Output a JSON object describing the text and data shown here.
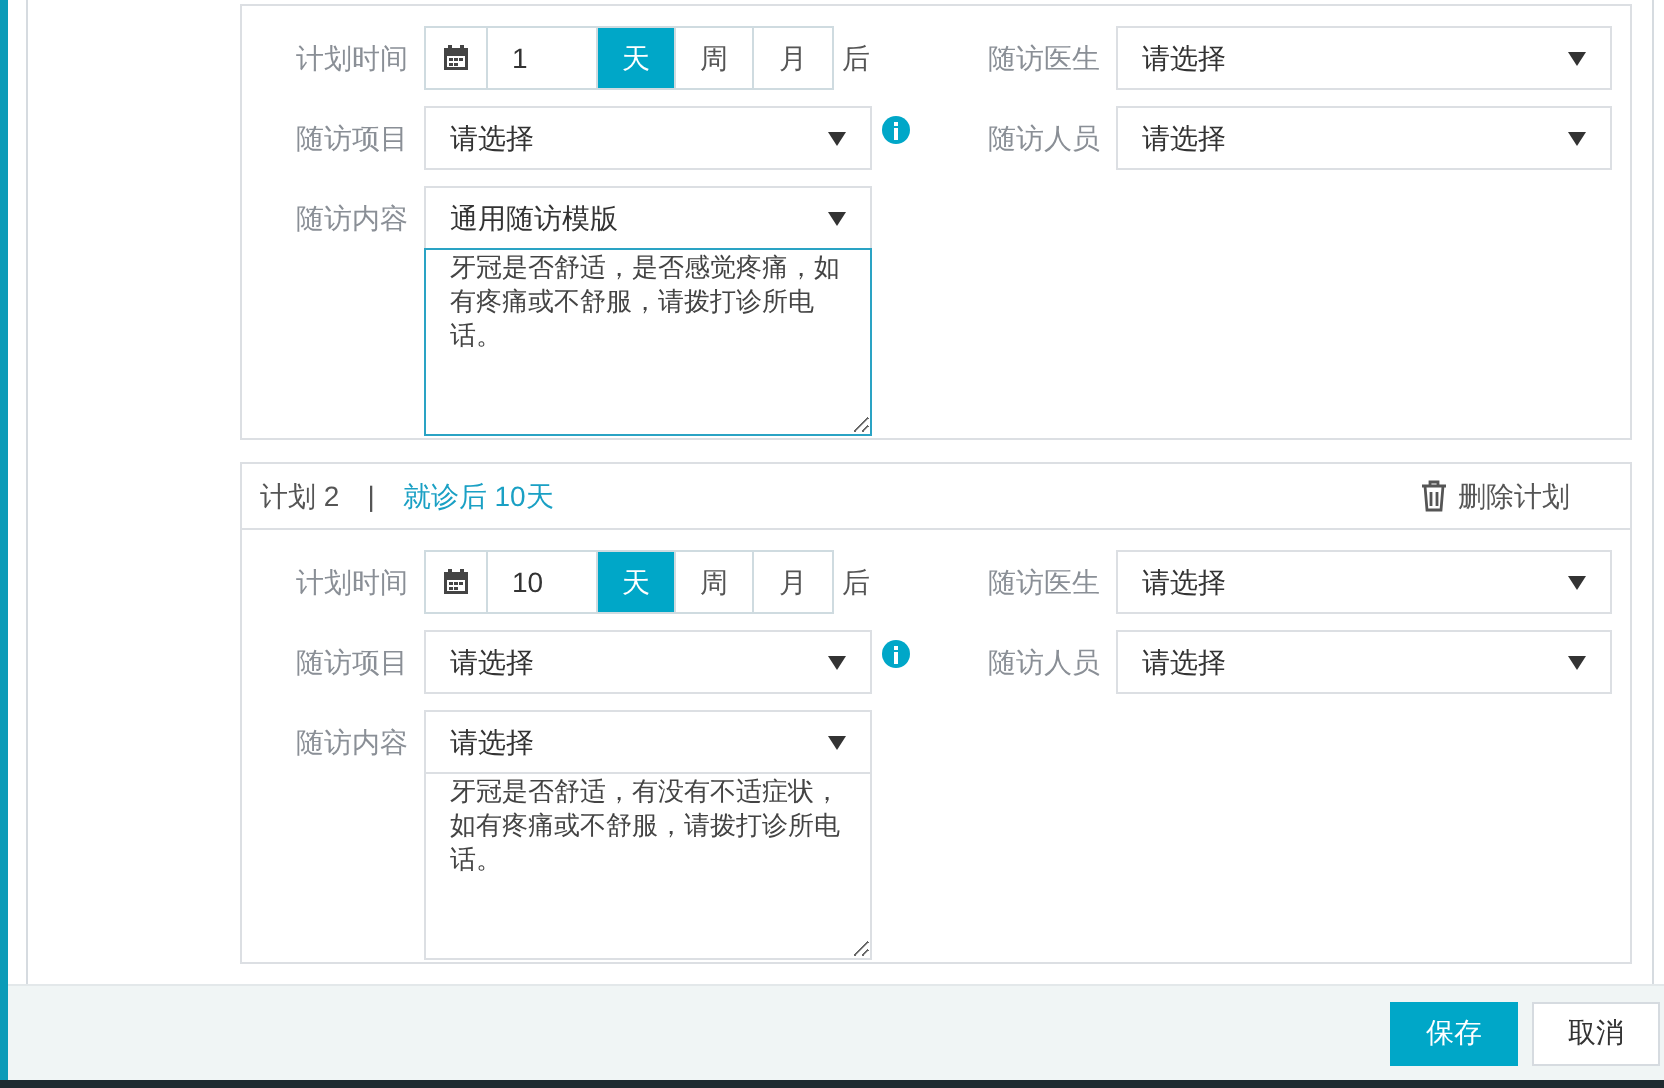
{
  "plans": [
    {
      "time": {
        "label": "计划时间",
        "value": "1",
        "units": [
          {
            "label": "天",
            "selected": true
          },
          {
            "label": "周",
            "selected": false
          },
          {
            "label": "月",
            "selected": false
          }
        ],
        "suffix": "后"
      },
      "doctor": {
        "label": "随访医生",
        "value": "请选择"
      },
      "item": {
        "label": "随访项目",
        "value": "请选择"
      },
      "staff": {
        "label": "随访人员",
        "value": "请选择"
      },
      "content": {
        "label": "随访内容",
        "value": "通用随访模版",
        "text": "牙冠是否舒适，是否感觉疼痛，如有疼痛或不舒服，请拨打诊所电话。",
        "focused": true
      }
    },
    {
      "header": {
        "title": "计划 2",
        "separator": "|",
        "summary": "就诊后 10天",
        "delete": "删除计划"
      },
      "time": {
        "label": "计划时间",
        "value": "10",
        "units": [
          {
            "label": "天",
            "selected": true
          },
          {
            "label": "周",
            "selected": false
          },
          {
            "label": "月",
            "selected": false
          }
        ],
        "suffix": "后"
      },
      "doctor": {
        "label": "随访医生",
        "value": "请选择"
      },
      "item": {
        "label": "随访项目",
        "value": "请选择"
      },
      "staff": {
        "label": "随访人员",
        "value": "请选择"
      },
      "content": {
        "label": "随访内容",
        "value": "请选择",
        "text": "牙冠是否舒适，有没有不适症状，如有疼痛或不舒服，请拨打诊所电话。",
        "focused": false
      }
    }
  ],
  "footer": {
    "save": "保存",
    "cancel": "取消"
  }
}
